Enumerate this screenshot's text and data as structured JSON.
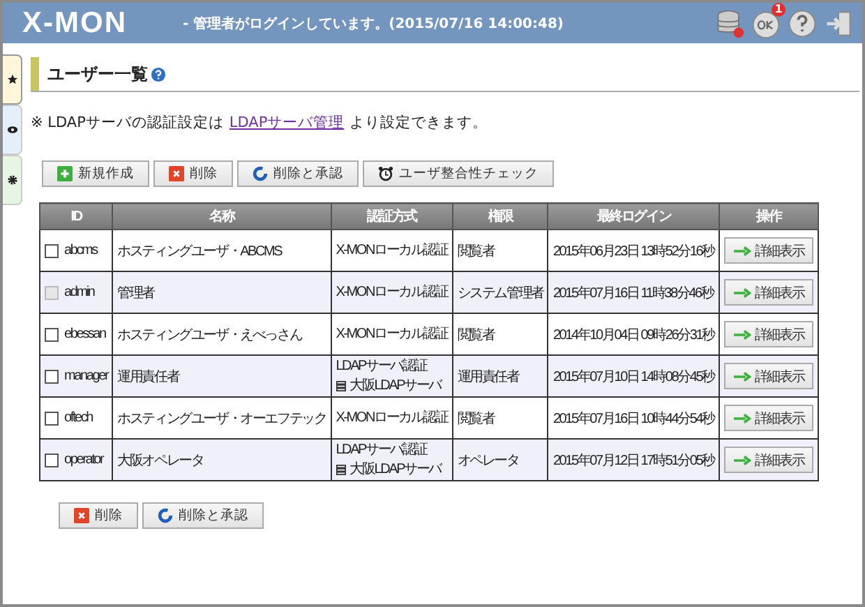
{
  "header": {
    "logo": "X-MON",
    "login_message": "- 管理者がログインしています。(2015/07/16 14:00:48)",
    "alert_badge": "1"
  },
  "side_tabs": [
    {
      "kind": "star",
      "selected": true
    },
    {
      "kind": "eye",
      "selected": false
    },
    {
      "kind": "gear",
      "selected": false
    }
  ],
  "page": {
    "title": "ユーザー一覧"
  },
  "notice": {
    "before": "※ LDAPサーバの認証設定は",
    "link": "LDAPサーバ管理",
    "after": "より設定できます。"
  },
  "toolbar": [
    {
      "kind": "add",
      "label": "新規作成"
    },
    {
      "kind": "delete",
      "label": "削除"
    },
    {
      "kind": "refresh",
      "label": "削除と承認"
    },
    {
      "kind": "check",
      "label": "ユーザ整合性チェック"
    }
  ],
  "table": {
    "columns": [
      "ID",
      "名称",
      "認証方式",
      "権限",
      "最終ログイン",
      "操作"
    ],
    "rows": [
      {
        "id": "abcms",
        "name": "ホスティングユーザ・ABCMS",
        "auth": {
          "kind": "local",
          "method": "X-MONローカル認証"
        },
        "role": "閲覧者",
        "last_login": "2015年06月23日 13時52分16秒",
        "action": "詳細表示",
        "checked": false,
        "disabled": false
      },
      {
        "id": "admin",
        "name": "管理者",
        "auth": {
          "kind": "local",
          "method": "X-MONローカル認証"
        },
        "role": "システム管理者",
        "last_login": "2015年07月16日 11時38分46秒",
        "action": "詳細表示",
        "checked": false,
        "disabled": true
      },
      {
        "id": "ebessan",
        "name": "ホスティングユーザ・えべっさん",
        "auth": {
          "kind": "local",
          "method": "X-MONローカル認証"
        },
        "role": "閲覧者",
        "last_login": "2014年10月04日 09時26分31秒",
        "action": "詳細表示",
        "checked": false,
        "disabled": false
      },
      {
        "id": "manager",
        "name": "運用責任者",
        "auth": {
          "kind": "ldap",
          "method": "LDAPサーバ認証",
          "server": "大阪LDAPサーバ"
        },
        "role": "運用責任者",
        "last_login": "2015年07月10日 14時08分45秒",
        "action": "詳細表示",
        "checked": false,
        "disabled": false
      },
      {
        "id": "oftech",
        "name": "ホスティングユーザ・オーエフテック",
        "auth": {
          "kind": "local",
          "method": "X-MONローカル認証"
        },
        "role": "閲覧者",
        "last_login": "2015年07月16日 10時44分54秒",
        "action": "詳細表示",
        "checked": false,
        "disabled": false
      },
      {
        "id": "operator",
        "name": "大阪オペレータ",
        "auth": {
          "kind": "ldap",
          "method": "LDAPサーバ認証",
          "server": "大阪LDAPサーバ"
        },
        "role": "オペレータ",
        "last_login": "2015年07月12日 17時51分05秒",
        "action": "詳細表示",
        "checked": false,
        "disabled": false
      }
    ]
  },
  "bottom_toolbar": [
    {
      "kind": "delete",
      "label": "削除"
    },
    {
      "kind": "refresh",
      "label": "削除と承認"
    }
  ]
}
